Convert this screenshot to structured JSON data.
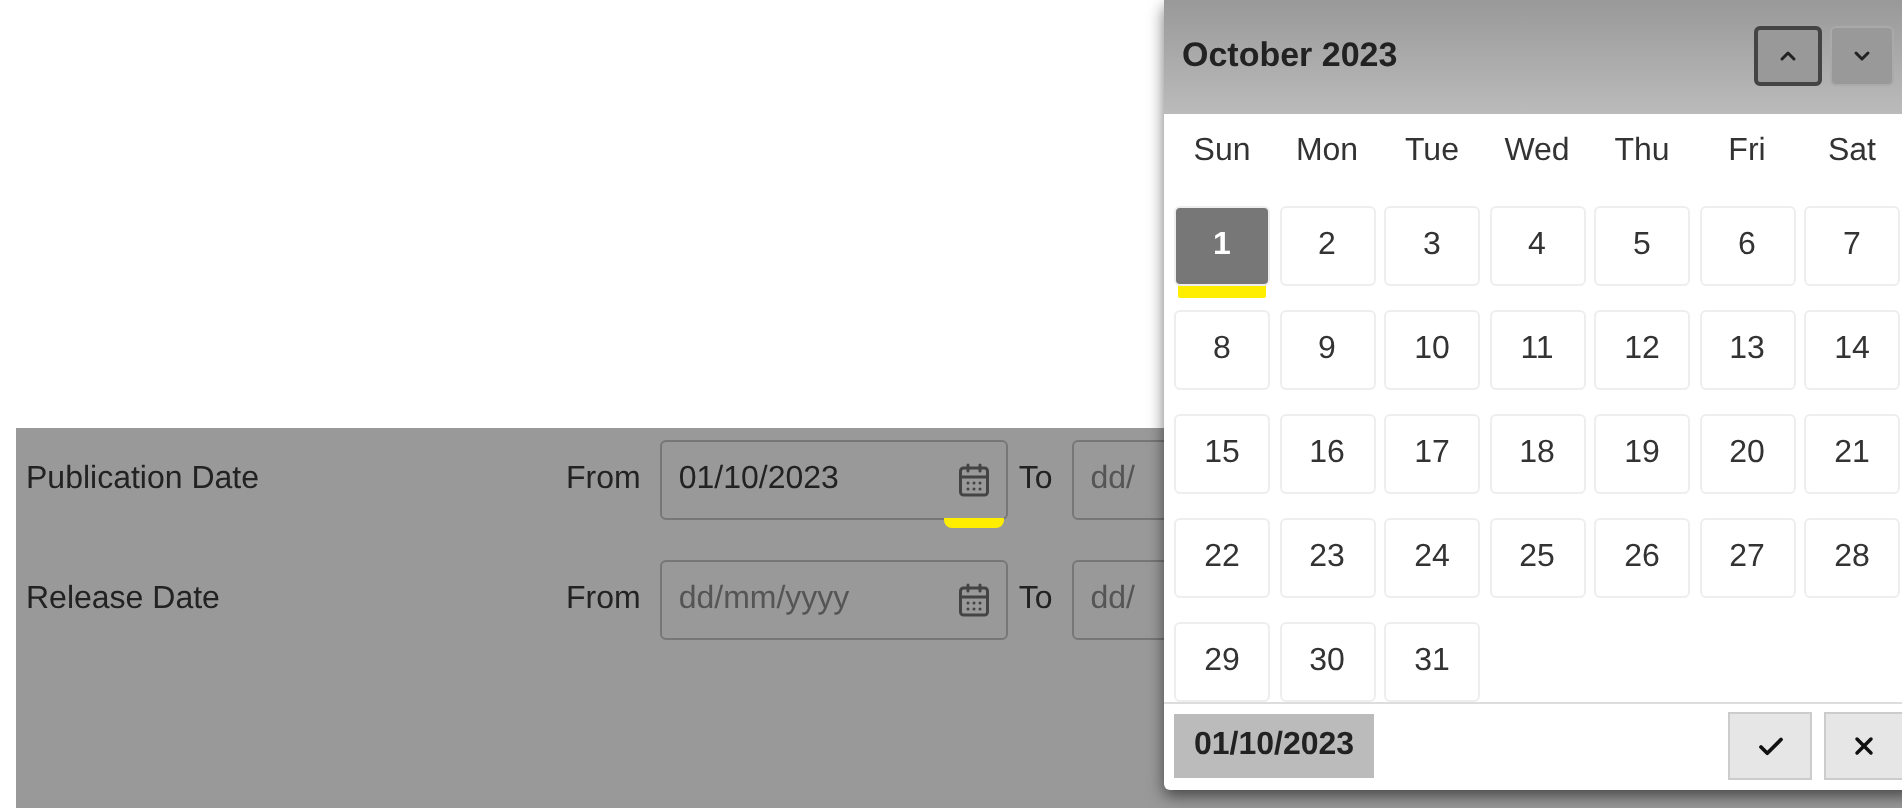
{
  "filters": [
    {
      "label": "Publication Date",
      "from_label": "From",
      "from": {
        "value": "01/10/2023",
        "icon_highlighted": true
      },
      "to_label": "To",
      "to": {
        "placeholder": "dd/"
      }
    },
    {
      "label": "Release Date",
      "from_label": "From",
      "from": {
        "placeholder": "dd/mm/yyyy",
        "icon_highlighted": false
      },
      "to_label": "To",
      "to": {
        "placeholder": "dd/"
      }
    }
  ],
  "calendar": {
    "title": "October 2023",
    "weekdays": [
      "Sun",
      "Mon",
      "Tue",
      "Wed",
      "Thu",
      "Fri",
      "Sat"
    ],
    "days": [
      {
        "label": "1",
        "selected": true,
        "highlighted": true
      },
      {
        "label": "2",
        "selected": false,
        "highlighted": false
      },
      {
        "label": "3",
        "selected": false,
        "highlighted": false
      },
      {
        "label": "4",
        "selected": false,
        "highlighted": false
      },
      {
        "label": "5",
        "selected": false,
        "highlighted": false
      },
      {
        "label": "6",
        "selected": false,
        "highlighted": false
      },
      {
        "label": "7",
        "selected": false,
        "highlighted": false
      },
      {
        "label": "8",
        "selected": false,
        "highlighted": false
      },
      {
        "label": "9",
        "selected": false,
        "highlighted": false
      },
      {
        "label": "10",
        "selected": false,
        "highlighted": false
      },
      {
        "label": "11",
        "selected": false,
        "highlighted": false
      },
      {
        "label": "12",
        "selected": false,
        "highlighted": false
      },
      {
        "label": "13",
        "selected": false,
        "highlighted": false
      },
      {
        "label": "14",
        "selected": false,
        "highlighted": false
      },
      {
        "label": "15",
        "selected": false,
        "highlighted": false
      },
      {
        "label": "16",
        "selected": false,
        "highlighted": false
      },
      {
        "label": "17",
        "selected": false,
        "highlighted": false
      },
      {
        "label": "18",
        "selected": false,
        "highlighted": false
      },
      {
        "label": "19",
        "selected": false,
        "highlighted": false
      },
      {
        "label": "20",
        "selected": false,
        "highlighted": false
      },
      {
        "label": "21",
        "selected": false,
        "highlighted": false
      },
      {
        "label": "22",
        "selected": false,
        "highlighted": false
      },
      {
        "label": "23",
        "selected": false,
        "highlighted": false
      },
      {
        "label": "24",
        "selected": false,
        "highlighted": false
      },
      {
        "label": "25",
        "selected": false,
        "highlighted": false
      },
      {
        "label": "26",
        "selected": false,
        "highlighted": false
      },
      {
        "label": "27",
        "selected": false,
        "highlighted": false
      },
      {
        "label": "28",
        "selected": false,
        "highlighted": false
      },
      {
        "label": "29",
        "selected": false,
        "highlighted": false
      },
      {
        "label": "30",
        "selected": false,
        "highlighted": false
      },
      {
        "label": "31",
        "selected": false,
        "highlighted": false
      }
    ],
    "selected_value": "01/10/2023"
  }
}
